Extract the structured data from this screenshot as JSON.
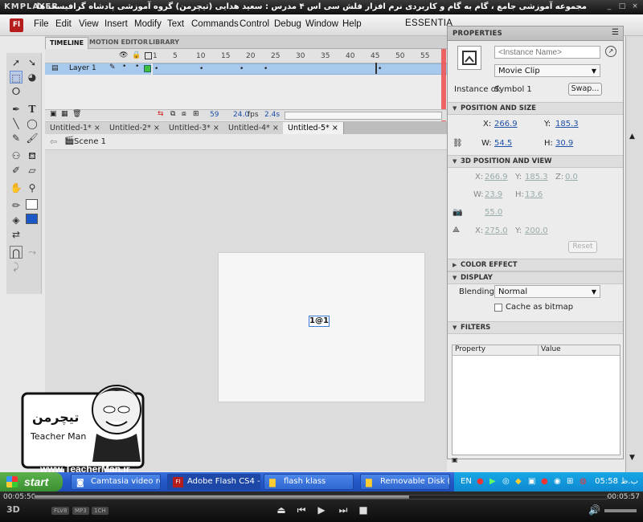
{
  "player": {
    "logo": "KMPLAYER",
    "title": "مجموعه آموزشی جامع ، گام به گام و کاربردی نرم افزار فلش سی اس ۴ مدرس : سعید هدایی (تیچرمن) گروه آموزشی پادشاه گرافیست ها",
    "time_elapsed": "00:05:50",
    "time_total": "00:05:57",
    "progress_fraction": 0.655,
    "badges": [
      "FLV8",
      "MP3",
      "1CH"
    ]
  },
  "menu": {
    "app_logo": "Fl",
    "items": [
      "File",
      "Edit",
      "View",
      "Insert",
      "Modify",
      "Text",
      "Commands",
      "Control",
      "Debug",
      "Window",
      "Help"
    ],
    "workspace": "ESSENTIA"
  },
  "timeline": {
    "tabs": [
      "TIMELINE",
      "MOTION EDITOR",
      "LIBRARY"
    ],
    "layer_name": "Layer 1",
    "frame_numbers": [
      "1",
      "5",
      "10",
      "15",
      "20",
      "25",
      "30",
      "35",
      "40",
      "45",
      "50",
      "55"
    ],
    "current_frame": "59",
    "fps": "24.0",
    "fps_unit": "fps",
    "time": "2.4s"
  },
  "documents": {
    "tabs": [
      "Untitled-1*",
      "Untitled-2*",
      "Untitled-3*",
      "Untitled-4*",
      "Untitled-5*"
    ],
    "active_index": 4,
    "scene": "Scene 1"
  },
  "stage": {
    "symbol_label": "1@1"
  },
  "properties": {
    "title": "PROPERTIES",
    "instance_name_placeholder": "<Instance Name>",
    "symbol_type": "Movie Clip",
    "instance_of_label": "Instance of:",
    "instance_of_value": "Symbol 1",
    "swap_button": "Swap...",
    "position_size": {
      "title": "POSITION AND SIZE",
      "x": "266.9",
      "y": "185.3",
      "w": "54.5",
      "h": "30.9"
    },
    "pos3d": {
      "title": "3D POSITION AND VIEW",
      "x": "266.9",
      "y": "185.3",
      "z": "0.0",
      "w": "23.9",
      "h": "13.6",
      "perspective": "55.0",
      "vanish_x": "275.0",
      "vanish_y": "200.0",
      "reset": "Reset"
    },
    "color_effect": {
      "title": "COLOR EFFECT"
    },
    "display": {
      "title": "DISPLAY",
      "blending_label": "Blending:",
      "blending_value": "Normal",
      "cache_label": "Cache as bitmap"
    },
    "filters": {
      "title": "FILTERS",
      "col_property": "Property",
      "col_value": "Value"
    }
  },
  "overlay": {
    "brand_fa": "تیچرمن",
    "brand_en": "Teacher Man",
    "site": "www.TeacherMan.ir"
  },
  "taskbar": {
    "start": "start",
    "tasks": [
      "Camtasia video reco...",
      "Adobe Flash CS4 - U...",
      "flash klass",
      "Removable Disk (H:)"
    ],
    "active_index": 1,
    "lang": "EN",
    "clock": "05:58 ب.ظ"
  },
  "colors": {
    "layer_row": "#a8c9ee",
    "taskbar": "#2459c9",
    "start": "#3a8f2f",
    "link_value": "#1e4fa8"
  }
}
